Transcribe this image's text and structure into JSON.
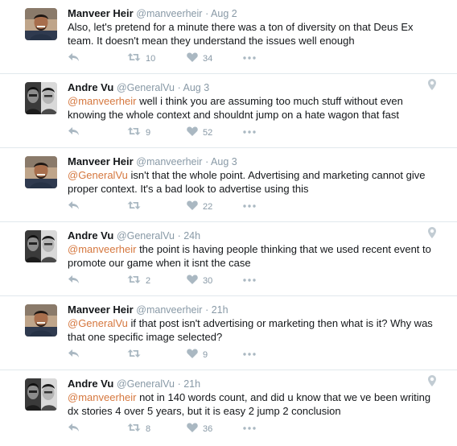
{
  "colors": {
    "mention": "#d5773e",
    "meta": "#8899a6",
    "icon": "#aab8c2",
    "divider": "#e1e8ed"
  },
  "tweets": [
    {
      "author": "Manveer Heir",
      "handle": "@manveerheir",
      "time": "Aug 2",
      "mention": "",
      "text": "Also, let's pretend for a minute there was a ton of diversity on that Deus Ex team. It doesn't mean they understand the issues well enough",
      "retweets": "10",
      "likes": "34",
      "geo": false,
      "avatar": "manveer"
    },
    {
      "author": "Andre Vu",
      "handle": "@GeneralVu",
      "time": "Aug 3",
      "mention": "@manveerheir",
      "text": " well i think you are assuming too much stuff without even knowing the whole context and shouldnt jump on a hate wagon that fast",
      "retweets": "9",
      "likes": "52",
      "geo": true,
      "avatar": "andre"
    },
    {
      "author": "Manveer Heir",
      "handle": "@manveerheir",
      "time": "Aug 3",
      "mention": "@GeneralVu",
      "text": " isn't that the whole point. Advertising and marketing cannot give proper context. It's a bad look to advertise using this",
      "retweets": "",
      "likes": "22",
      "geo": false,
      "avatar": "manveer"
    },
    {
      "author": "Andre Vu",
      "handle": "@GeneralVu",
      "time": "24h",
      "mention": "@manveerheir",
      "text": " the point is having people thinking that we used recent event to promote our game when it isnt the case",
      "retweets": "2",
      "likes": "30",
      "geo": true,
      "avatar": "andre"
    },
    {
      "author": "Manveer Heir",
      "handle": "@manveerheir",
      "time": "21h",
      "mention": "@GeneralVu",
      "text": " if that post isn't advertising or marketing then what is it? Why was that one specific image selected?",
      "retweets": "",
      "likes": "9",
      "geo": false,
      "avatar": "manveer"
    },
    {
      "author": "Andre Vu",
      "handle": "@GeneralVu",
      "time": "21h",
      "mention": "@manveerheir",
      "text": " not in 140 words count, and did u know that we ve been writing dx stories 4 over 5 years, but it is easy 2 jump 2 conclusion",
      "retweets": "8",
      "likes": "36",
      "geo": true,
      "avatar": "andre"
    }
  ],
  "separator": "·"
}
